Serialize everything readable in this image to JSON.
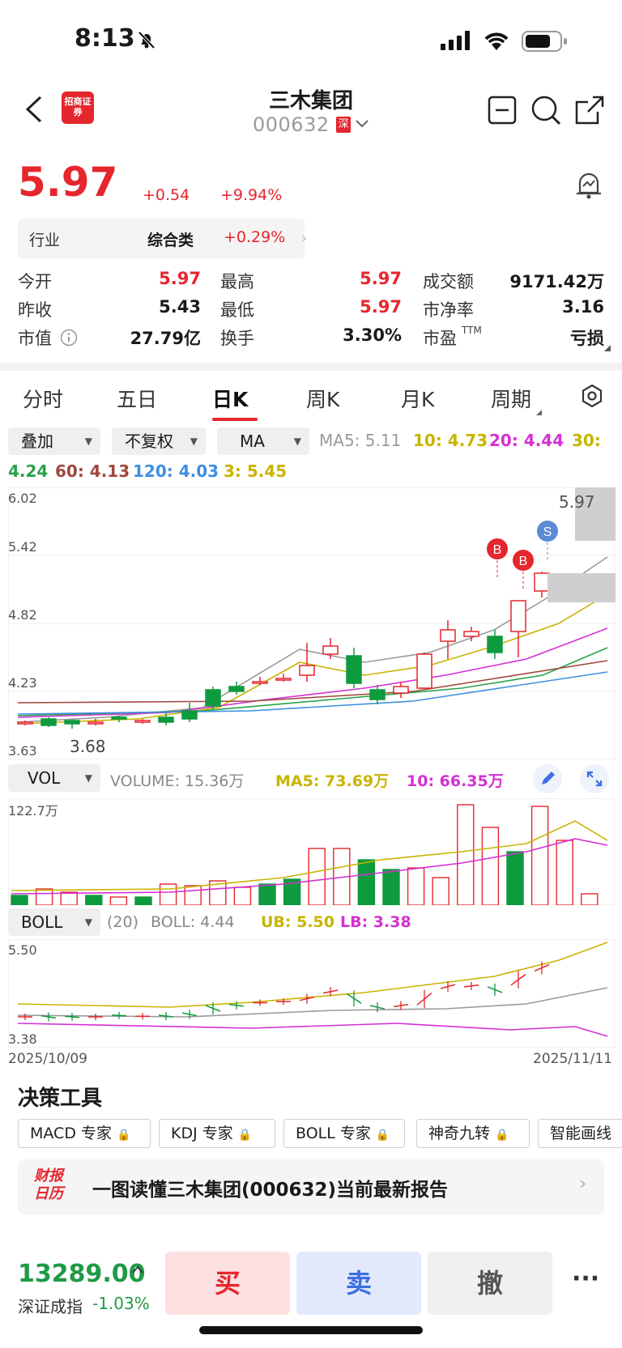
{
  "status_bar": {
    "time": "8:13"
  },
  "header": {
    "title": "三木集团",
    "code": "000632",
    "exchange_badge": "深",
    "broker_logo_text": "招商证券",
    "icons": [
      "back-icon",
      "minimize-icon",
      "search-icon",
      "share-icon"
    ]
  },
  "quote": {
    "price": "5.97",
    "change": "+0.54",
    "change_pct": "+9.94%",
    "industry_label": "行业",
    "industry_name": "综合类",
    "industry_pct": "+0.29%",
    "rows": [
      [
        {
          "label": "今开",
          "value": "5.97",
          "color": "red"
        },
        {
          "label": "最高",
          "value": "5.97",
          "color": "red"
        },
        {
          "label": "成交额",
          "value": "9171.42万",
          "color": "black"
        }
      ],
      [
        {
          "label": "昨收",
          "value": "5.43",
          "color": "black"
        },
        {
          "label": "最低",
          "value": "5.97",
          "color": "red"
        },
        {
          "label": "市净率",
          "value": "3.16",
          "color": "black"
        }
      ],
      [
        {
          "label": "市值",
          "value": "27.79亿",
          "color": "black"
        },
        {
          "label": "换手",
          "value": "3.30%",
          "color": "black"
        },
        {
          "label": "市盈",
          "value": "亏损",
          "color": "black"
        }
      ]
    ],
    "pe_suffix": "TTM"
  },
  "tabs": [
    "分时",
    "五日",
    "日K",
    "周K",
    "月K",
    "周期"
  ],
  "active_tab": "日K",
  "controls": {
    "overlay": "叠加",
    "adjust": "不复权",
    "indicator": "MA"
  },
  "ma_legend": [
    {
      "text": "MA5: 5.11",
      "color": "#9a9a9a"
    },
    {
      "text": "10: 4.73",
      "color": "#c8b400"
    },
    {
      "text": "20: 4.44",
      "color": "#d430d4"
    },
    {
      "text": "30:",
      "color": "#c8b400"
    },
    {
      "text": "4.24",
      "color": "#2aa24a"
    },
    {
      "text": "60: 4.13",
      "color": "#a0483c"
    },
    {
      "text": "120: 4.03",
      "color": "#3d8fe0"
    },
    {
      "text": "3: 5.45",
      "color": "#c8b400"
    }
  ],
  "kline": {
    "y_labels": [
      "6.02",
      "5.42",
      "4.82",
      "4.23",
      "3.63"
    ],
    "low_marker": "3.68",
    "high_marker": "5.97",
    "signals": [
      "B",
      "B",
      "S"
    ]
  },
  "volume": {
    "selector": "VOL",
    "volume_text": "VOLUME: 15.36万",
    "ma5_text": "MA5: 73.69万",
    "ma10_text": "10: 66.35万",
    "top_label": "122.7万"
  },
  "boll": {
    "selector": "BOLL",
    "params": "(20)",
    "boll_text": "BOLL: 4.44",
    "ub_text": "UB: 5.50",
    "lb_text": "LB: 3.38",
    "top_label": "5.50",
    "bottom_label": "3.38",
    "start_date": "2025/10/09",
    "end_date": "2025/11/11"
  },
  "tools": {
    "title": "决策工具",
    "chips": [
      "MACD 专家",
      "KDJ 专家",
      "BOLL 专家",
      "神奇九转",
      "智能画线"
    ]
  },
  "report": {
    "logo_text": "财报日历",
    "text": "一图读懂三木集团(000632)当前最新报告"
  },
  "bottom": {
    "index_value": "13289.00",
    "index_name": "深证成指",
    "index_pct": "-1.03%",
    "buy": "买",
    "sell": "卖",
    "cancel": "撤",
    "more": "···"
  }
}
